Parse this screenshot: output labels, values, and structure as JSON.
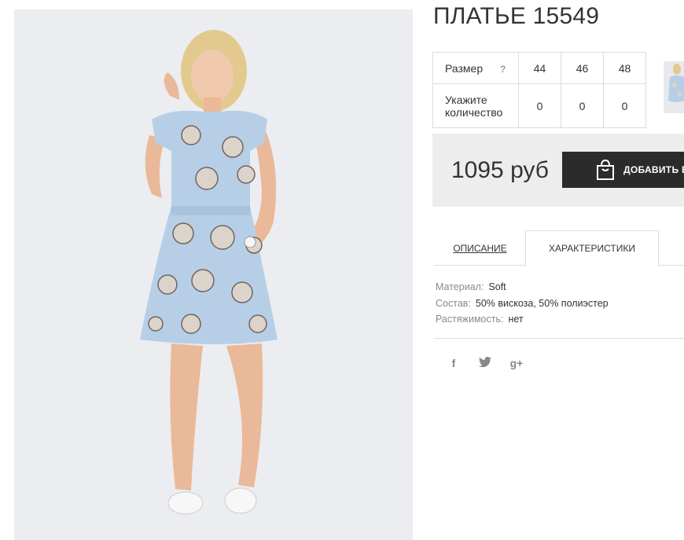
{
  "product": {
    "title": "ПЛАТЬЕ 15549",
    "image_alt": "dress-photo"
  },
  "size_table": {
    "size_label": "Размер",
    "help": "?",
    "sizes": [
      "44",
      "46",
      "48"
    ],
    "qty_label": "Укажите количество",
    "quantities": [
      "0",
      "0",
      "0"
    ]
  },
  "purchase": {
    "price": "1095 руб",
    "add_button": "ДОБАВИТЬ В"
  },
  "tabs": {
    "description": "ОПИСАНИЕ",
    "characteristics": "ХАРАКТЕРИСТИКИ"
  },
  "specs": [
    {
      "key": "Материал:",
      "value": "Soft"
    },
    {
      "key": "Состав:",
      "value": "50% вискоза, 50% полиэстер"
    },
    {
      "key": "Растяжимость:",
      "value": "нет"
    }
  ],
  "social": {
    "facebook": "f",
    "twitter": "t",
    "google_plus": "g+"
  },
  "colors": {
    "dress": "#b7cfe6",
    "button": "#2b2b2b",
    "price_bg": "#ededed"
  }
}
